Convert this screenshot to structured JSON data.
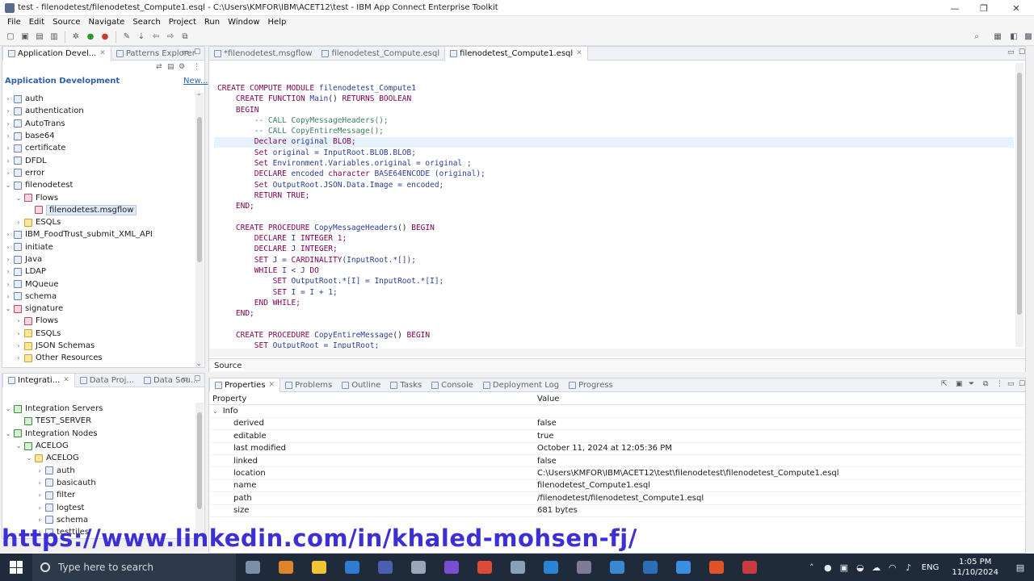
{
  "window": {
    "title": "test - filenodetest/filenodetest_Compute1.esql - C:\\Users\\KMFOR\\IBM\\ACET12\\test - IBM App Connect Enterprise Toolkit",
    "controls": [
      "—",
      "❐",
      "✕"
    ]
  },
  "menu": [
    "File",
    "Edit",
    "Source",
    "Navigate",
    "Search",
    "Project",
    "Run",
    "Window",
    "Help"
  ],
  "app_dev_panel": {
    "tabs": [
      "Application Devel...",
      "Patterns Explorer"
    ],
    "header_title": "Application Development",
    "header_link": "New...",
    "tree": [
      {
        "label": "auth",
        "level": 0,
        "twisty": "›",
        "icon": "project"
      },
      {
        "label": "authentication",
        "level": 0,
        "twisty": "›",
        "icon": "project"
      },
      {
        "label": "AutoTrans",
        "level": 0,
        "twisty": "›",
        "icon": "project"
      },
      {
        "label": "base64",
        "level": 0,
        "twisty": "›",
        "icon": "project"
      },
      {
        "label": "certificate",
        "level": 0,
        "twisty": "›",
        "icon": "project"
      },
      {
        "label": "DFDL",
        "level": 0,
        "twisty": "›",
        "icon": "project"
      },
      {
        "label": "error",
        "level": 0,
        "twisty": "›",
        "icon": "project"
      },
      {
        "label": "filenodetest",
        "level": 0,
        "twisty": "⌄",
        "icon": "project"
      },
      {
        "label": "Flows",
        "level": 1,
        "twisty": "⌄",
        "icon": "flow"
      },
      {
        "label": "filenodetest.msgflow",
        "level": 2,
        "twisty": "",
        "icon": "flow",
        "selected": true
      },
      {
        "label": "ESQLs",
        "level": 1,
        "twisty": "›",
        "icon": "folder"
      },
      {
        "label": "IBM_FoodTrust_submit_XML_API",
        "level": 0,
        "twisty": "›",
        "icon": "project"
      },
      {
        "label": "initiate",
        "level": 0,
        "twisty": "›",
        "icon": "project"
      },
      {
        "label": "Java",
        "level": 0,
        "twisty": "›",
        "icon": "project"
      },
      {
        "label": "LDAP",
        "level": 0,
        "twisty": "›",
        "icon": "project"
      },
      {
        "label": "MQueue",
        "level": 0,
        "twisty": "›",
        "icon": "project"
      },
      {
        "label": "schema",
        "level": 0,
        "twisty": "›",
        "icon": "project"
      },
      {
        "label": "signature",
        "level": 0,
        "twisty": "⌄",
        "icon": "flow"
      },
      {
        "label": "Flows",
        "level": 1,
        "twisty": "›",
        "icon": "flow"
      },
      {
        "label": "ESQLs",
        "level": 1,
        "twisty": "›",
        "icon": "folder"
      },
      {
        "label": "JSON Schemas",
        "level": 1,
        "twisty": "›",
        "icon": "folder"
      },
      {
        "label": "Other Resources",
        "level": 1,
        "twisty": "›",
        "icon": "folder"
      }
    ]
  },
  "integration_panel": {
    "tabs": [
      "Integrati...",
      "Data Proj...",
      "Data Sou..."
    ],
    "tree": [
      {
        "label": "Integration Servers",
        "level": 0,
        "twisty": "⌄",
        "icon": "server"
      },
      {
        "label": "TEST_SERVER",
        "level": 1,
        "twisty": "",
        "icon": "server"
      },
      {
        "label": "Integration Nodes",
        "level": 0,
        "twisty": "⌄",
        "icon": "server"
      },
      {
        "label": "ACELOG",
        "level": 1,
        "twisty": "⌄",
        "icon": "server"
      },
      {
        "label": "ACELOG",
        "level": 2,
        "twisty": "⌄",
        "icon": "folder"
      },
      {
        "label": "auth",
        "level": 3,
        "twisty": "›",
        "icon": "project"
      },
      {
        "label": "basicauth",
        "level": 3,
        "twisty": "›",
        "icon": "project"
      },
      {
        "label": "filter",
        "level": 3,
        "twisty": "›",
        "icon": "project"
      },
      {
        "label": "logtest",
        "level": 3,
        "twisty": "›",
        "icon": "project"
      },
      {
        "label": "schema",
        "level": 3,
        "twisty": "›",
        "icon": "project"
      },
      {
        "label": "testtiles",
        "level": 3,
        "twisty": "›",
        "icon": "project"
      }
    ]
  },
  "editor": {
    "tabs": [
      "*filenodetest.msgflow",
      "filenodetest_Compute.esql",
      "filenodetest_Compute1.esql"
    ],
    "active_tab": 2,
    "bottom_tab": "Source",
    "code": [
      [
        {
          "t": "CREATE COMPUTE MODULE ",
          "c": "kw"
        },
        {
          "t": "filenodetest_Compute1",
          "c": "id"
        }
      ],
      [
        {
          "t": "    CREATE FUNCTION ",
          "c": "kw"
        },
        {
          "t": "Main",
          "c": "id"
        },
        {
          "t": "() ",
          "c": ""
        },
        {
          "t": "RETURNS BOOLEAN",
          "c": "kw"
        }
      ],
      [
        {
          "t": "    BEGIN",
          "c": "kw"
        }
      ],
      [
        {
          "t": "        -- CALL CopyMessageHeaders();",
          "c": "cm"
        }
      ],
      [
        {
          "t": "        -- CALL CopyEntireMessage();",
          "c": "cm"
        }
      ],
      [
        {
          "t": "        Declare ",
          "c": "kw"
        },
        {
          "t": "original ",
          "c": "id"
        },
        {
          "t": "BLOB;",
          "c": "kw"
        }
      ],
      [
        {
          "t": "        Set ",
          "c": "kw"
        },
        {
          "t": "original = InputRoot.BLOB.BLOB;",
          "c": "id"
        }
      ],
      [
        {
          "t": "        Set ",
          "c": "kw"
        },
        {
          "t": "Environment.Variables.original = original ;",
          "c": "id"
        }
      ],
      [
        {
          "t": "        DECLARE ",
          "c": "kw"
        },
        {
          "t": "encoded ",
          "c": "id"
        },
        {
          "t": "character ",
          "c": "kw"
        },
        {
          "t": "BASE64ENCODE (original);",
          "c": "id"
        }
      ],
      [
        {
          "t": "        Set ",
          "c": "kw"
        },
        {
          "t": "OutputRoot.JSON.Data.Image = encoded;",
          "c": "id"
        }
      ],
      [
        {
          "t": "        RETURN TRUE;",
          "c": "kw"
        }
      ],
      [
        {
          "t": "    END;",
          "c": "kw"
        }
      ],
      [
        {
          "t": "",
          "c": ""
        }
      ],
      [
        {
          "t": "    CREATE PROCEDURE ",
          "c": "kw"
        },
        {
          "t": "CopyMessageHeaders",
          "c": "id"
        },
        {
          "t": "() ",
          "c": ""
        },
        {
          "t": "BEGIN",
          "c": "kw"
        }
      ],
      [
        {
          "t": "        DECLARE ",
          "c": "kw"
        },
        {
          "t": "I ",
          "c": "id"
        },
        {
          "t": "INTEGER 1;",
          "c": "kw"
        }
      ],
      [
        {
          "t": "        DECLARE ",
          "c": "kw"
        },
        {
          "t": "J ",
          "c": "id"
        },
        {
          "t": "INTEGER;",
          "c": "kw"
        }
      ],
      [
        {
          "t": "        SET ",
          "c": "kw"
        },
        {
          "t": "J = ",
          "c": "id"
        },
        {
          "t": "CARDINALITY",
          "c": "kw"
        },
        {
          "t": "(InputRoot.*[]);",
          "c": "id"
        }
      ],
      [
        {
          "t": "        WHILE ",
          "c": "kw"
        },
        {
          "t": "I < J ",
          "c": "id"
        },
        {
          "t": "DO",
          "c": "kw"
        }
      ],
      [
        {
          "t": "            SET ",
          "c": "kw"
        },
        {
          "t": "OutputRoot.*[I] = InputRoot.*[I];",
          "c": "id"
        }
      ],
      [
        {
          "t": "            SET ",
          "c": "kw"
        },
        {
          "t": "I = I + 1;",
          "c": "id"
        }
      ],
      [
        {
          "t": "        END WHILE;",
          "c": "kw"
        }
      ],
      [
        {
          "t": "    END;",
          "c": "kw"
        }
      ],
      [
        {
          "t": "",
          "c": ""
        }
      ],
      [
        {
          "t": "    CREATE PROCEDURE ",
          "c": "kw"
        },
        {
          "t": "CopyEntireMessage",
          "c": "id"
        },
        {
          "t": "() ",
          "c": ""
        },
        {
          "t": "BEGIN",
          "c": "kw"
        }
      ],
      [
        {
          "t": "        SET ",
          "c": "kw"
        },
        {
          "t": "OutputRoot = InputRoot;",
          "c": "id"
        }
      ]
    ]
  },
  "properties_panel": {
    "tabs": [
      "Properties",
      "Problems",
      "Outline",
      "Tasks",
      "Console",
      "Deployment Log",
      "Progress"
    ],
    "col_property": "Property",
    "col_value": "Value",
    "group": "Info",
    "rows": [
      {
        "k": "derived",
        "v": "false"
      },
      {
        "k": "editable",
        "v": "true"
      },
      {
        "k": "last modified",
        "v": "October 11, 2024 at 12:05:36 PM"
      },
      {
        "k": "linked",
        "v": "false"
      },
      {
        "k": "location",
        "v": "C:\\Users\\KMFOR\\IBM\\ACET12\\test\\filenodetest\\filenodetest_Compute1.esql"
      },
      {
        "k": "name",
        "v": "filenodetest_Compute1.esql"
      },
      {
        "k": "path",
        "v": "/filenodetest/filenodetest_Compute1.esql"
      },
      {
        "k": "size",
        "v": "681  bytes"
      }
    ]
  },
  "watermark": "https://www.linkedin.com/in/khaled-mohsen-fj/",
  "taskbar": {
    "search_placeholder": "Type here to search",
    "apps": [
      "#7b8fa6",
      "#e0842a",
      "#f2c434",
      "#2f7bd1",
      "#4a5fb0",
      "#9aa7b8",
      "#7a4fcf",
      "#dd4a3a",
      "#8aa0b8",
      "#2a84d6",
      "#7f7a9a",
      "#3a88d0",
      "#2a6fb8",
      "#3a8fe0",
      "#e0532a",
      "#c93a3a"
    ],
    "lang": "ENG",
    "time": "1:05 PM",
    "date": "11/10/2024"
  }
}
